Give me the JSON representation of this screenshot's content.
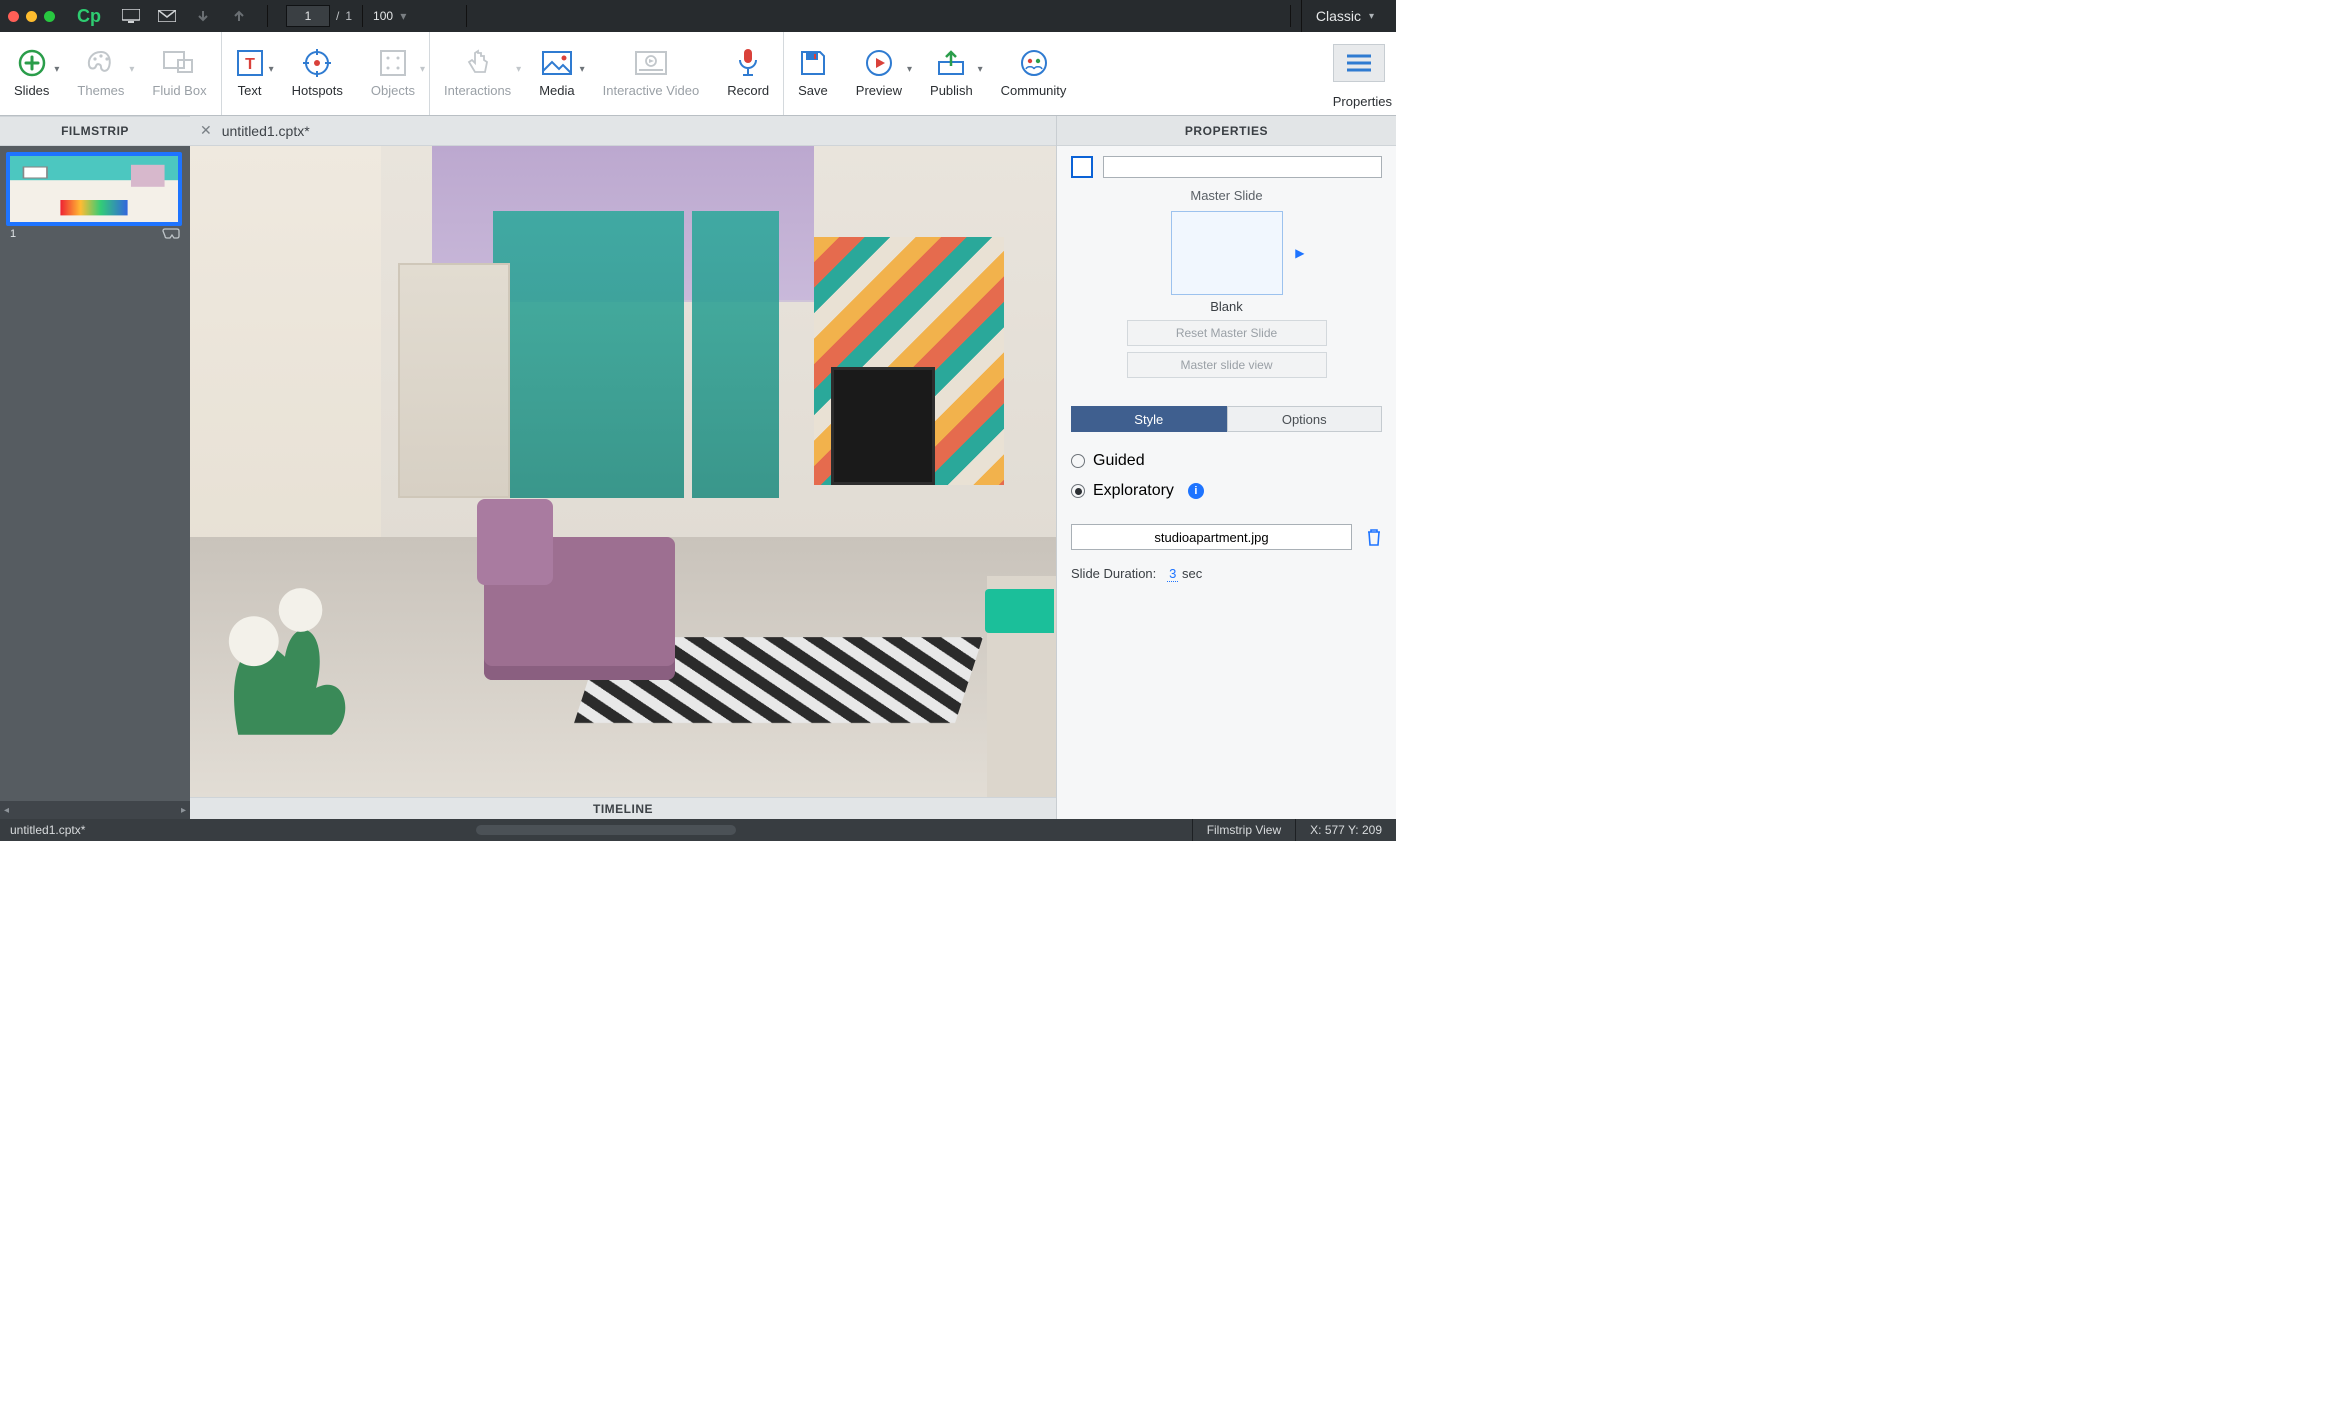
{
  "menubar": {
    "page_current": "1",
    "page_sep": "/",
    "page_total": "1",
    "zoom": "100",
    "workspace": "Classic"
  },
  "toolbar": {
    "slides": "Slides",
    "themes": "Themes",
    "fluidbox": "Fluid Box",
    "text": "Text",
    "hotspots": "Hotspots",
    "objects": "Objects",
    "interactions": "Interactions",
    "media": "Media",
    "interactive_video": "Interactive Video",
    "record": "Record",
    "save": "Save",
    "preview": "Preview",
    "publish": "Publish",
    "community": "Community",
    "properties": "Properties"
  },
  "filmstrip": {
    "title": "FILMSTRIP",
    "thumb_num": "1"
  },
  "tabs": {
    "filename": "untitled1.cptx*"
  },
  "timeline": {
    "label": "TIMELINE"
  },
  "panel": {
    "title": "PROPERTIES",
    "name_value": "",
    "master_slide": "Master Slide",
    "blank": "Blank",
    "reset": "Reset Master Slide",
    "msview": "Master slide view",
    "tab_style": "Style",
    "tab_options": "Options",
    "guided": "Guided",
    "exploratory": "Exploratory",
    "file": "studioapartment.jpg",
    "dur_label": "Slide Duration:",
    "dur_val": "3",
    "dur_unit": "sec"
  },
  "status": {
    "filename": "untitled1.cptx*",
    "view": "Filmstrip View",
    "coords": "X: 577 Y: 209"
  }
}
